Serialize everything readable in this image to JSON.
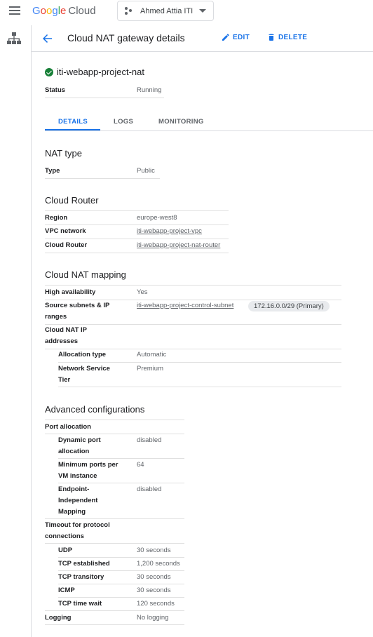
{
  "topbar": {
    "logo": {
      "letters": [
        "G",
        "o",
        "o",
        "g",
        "l",
        "e"
      ],
      "product": "Cloud"
    },
    "project": "Ahmed Attia ITI"
  },
  "header": {
    "title": "Cloud NAT gateway details",
    "edit_label": "EDIT",
    "delete_label": "DELETE"
  },
  "gateway": {
    "name": "iti-webapp-project-nat",
    "status_label": "Status",
    "status_value": "Running"
  },
  "tabs": [
    "DETAILS",
    "LOGS",
    "MONITORING"
  ],
  "nat_type": {
    "title": "NAT type",
    "type_label": "Type",
    "type_value": "Public"
  },
  "cloud_router": {
    "title": "Cloud Router",
    "region_label": "Region",
    "region_value": "europe-west8",
    "vpc_label": "VPC network",
    "vpc_value": "iti-webapp-project-vpc",
    "router_label": "Cloud Router",
    "router_value": "iti-webapp-project-nat-router"
  },
  "mapping": {
    "title": "Cloud NAT mapping",
    "ha_label": "High availability",
    "ha_value": "Yes",
    "subnets_label_1": "Source subnets & IP",
    "subnets_label_2": "ranges",
    "subnet_value": "iti-webapp-project-control-subnet",
    "subnet_chip": "172.16.0.0/29 (Primary)",
    "ipaddr_label_1": "Cloud NAT IP",
    "ipaddr_label_2": "addresses",
    "alloc_label": "Allocation type",
    "alloc_value": "Automatic",
    "tier_label_1": "Network Service",
    "tier_label_2": "Tier",
    "tier_value": "Premium"
  },
  "advanced": {
    "title": "Advanced configurations",
    "port_alloc_label": "Port allocation",
    "dyn_label_1": "Dynamic port",
    "dyn_label_2": "allocation",
    "dyn_value": "disabled",
    "minports_label_1": "Minimum ports per",
    "minports_label_2": "VM instance",
    "minports_value": "64",
    "eim_label_1": "Endpoint-",
    "eim_label_2": "Independent",
    "eim_label_3": "Mapping",
    "eim_value": "disabled",
    "timeout_label_1": "Timeout for protocol",
    "timeout_label_2": "connections",
    "udp_label": "UDP",
    "udp_value": "30 seconds",
    "tcpest_label": "TCP established",
    "tcpest_value": "1,200 seconds",
    "tcptr_label": "TCP transitory",
    "tcptr_value": "30 seconds",
    "icmp_label": "ICMP",
    "icmp_value": "30 seconds",
    "tcptw_label": "TCP time wait",
    "tcptw_value": "120 seconds",
    "logging_label": "Logging",
    "logging_value": "No logging"
  }
}
